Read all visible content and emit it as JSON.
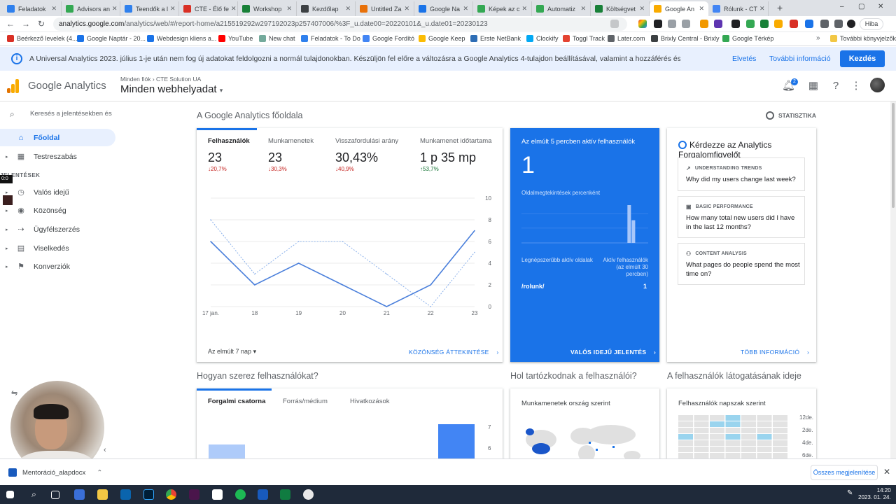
{
  "browser": {
    "tabs": [
      {
        "title": "Feladatok",
        "color": "#2f80ed"
      },
      {
        "title": "Advisors an",
        "color": "#34a853"
      },
      {
        "title": "Teendők a l",
        "color": "#2f80ed"
      },
      {
        "title": "CTE - Élő fe",
        "color": "#d93025"
      },
      {
        "title": "Workshop",
        "color": "#188038"
      },
      {
        "title": "Kezdőlap",
        "color": "#3c4043"
      },
      {
        "title": "Untitled Za",
        "color": "#e8710a"
      },
      {
        "title": "Google Na",
        "color": "#1a73e8"
      },
      {
        "title": "Képek az c",
        "color": "#34a853"
      },
      {
        "title": "Automatiz",
        "color": "#34a853"
      },
      {
        "title": "Költségvet",
        "color": "#188038"
      },
      {
        "title": "Google An",
        "color": "#f9ab00"
      },
      {
        "title": "Rólunk - CT",
        "color": "#4285f4"
      }
    ],
    "url_host": "analytics.google.com",
    "url_path": "/analytics/web/#/report-home/a215519292w297192023p257407006/%3F_u.date00=20220101&_u.date01=20230123",
    "profile_button": "Hiba",
    "bookmarks": [
      "Beérkező levelek (4...",
      "Google Naptár - 20...",
      "Webdesign kliens a...",
      "YouTube",
      "New chat",
      "Feladatok - To Do",
      "Google Fordító",
      "Google Keep",
      "Erste NetBank",
      "Clockify",
      "Toggl Track",
      "Later.com",
      "Brixly Central - Brixly",
      "Google Térkép"
    ],
    "other_bookmarks": "További könyvjelzők"
  },
  "banner": {
    "message": "A Universal Analytics 2023. július 1-je után nem fog új adatokat feldolgozni a normál tulajdonokban. Készüljön fel előre a változásra a Google Analytics 4-tulajdon beállításával, valamint a hozzáférés és eszközök beállításával.",
    "dismiss": "Elvetés",
    "more": "További információ",
    "start": "Kezdés"
  },
  "header": {
    "product": "Google Analytics",
    "crumb_root": "Minden fiók",
    "crumb_account": "CTE Solution UA",
    "view": "Minden webhelyadat",
    "notifications": "2"
  },
  "sidebar": {
    "search_placeholder": "Keresés a jelentésekben és",
    "items": [
      {
        "label": "Főoldal",
        "icon": "home-icon",
        "glyph": "⌂"
      },
      {
        "label": "Testreszabás",
        "icon": "dashboard-icon",
        "glyph": "▦"
      }
    ],
    "section": "JELENTÉSEK",
    "reports": [
      {
        "label": "Valós idejű",
        "icon": "clock-icon",
        "glyph": "◷"
      },
      {
        "label": "Közönség",
        "icon": "person-icon",
        "glyph": "◉"
      },
      {
        "label": "Ügyfélszerzés",
        "icon": "acquisition-icon",
        "glyph": "⇢"
      },
      {
        "label": "Viselkedés",
        "icon": "behavior-icon",
        "glyph": "▤"
      },
      {
        "label": "Konverziók",
        "icon": "flag-icon",
        "glyph": "⚑"
      }
    ],
    "timer": "0:0"
  },
  "main": {
    "title": "A Google Analytics főoldala",
    "insights_link": "STATISZTIKA",
    "metrics": [
      {
        "label": "Felhasználók",
        "value": "23",
        "delta": "20,7%",
        "dir": "down"
      },
      {
        "label": "Munkamenetek",
        "value": "23",
        "delta": "30,3%",
        "dir": "down"
      },
      {
        "label": "Visszafordulási arány",
        "value": "30,43%",
        "delta": "40,9%",
        "dir": "down"
      },
      {
        "label": "Munkamenet időtartama",
        "value": "1 p 35 mp",
        "delta": "53,7%",
        "dir": "up"
      }
    ],
    "range": "Az elmúlt 7 nap",
    "audience_link": "KÖZÖNSÉG ÁTTEKINTÉSE"
  },
  "chart_data": {
    "type": "line",
    "x": [
      "17 jan.",
      "18",
      "19",
      "20",
      "21",
      "22",
      "23"
    ],
    "ylim": [
      0,
      10
    ],
    "yticks": [
      "0",
      "2",
      "4",
      "6",
      "8",
      "10"
    ],
    "series": [
      {
        "values": [
          6,
          2,
          4,
          2,
          0,
          2,
          7
        ]
      },
      {
        "values": [
          8,
          3,
          6,
          6,
          3,
          0,
          5
        ]
      }
    ],
    "colors": {
      "current": "#4a7fdb",
      "previous": "#8ab0ea"
    }
  },
  "realtime": {
    "title": "Az elmúlt 5 percben aktív felhasználók",
    "value": "1",
    "pageviews_label": "Oldalmegtekintések percenként",
    "pageviews_per_minute": [
      0,
      0,
      0,
      0,
      0,
      0,
      0,
      0,
      0,
      0,
      0,
      0,
      0,
      0,
      0,
      0,
      0,
      0,
      0,
      0,
      0,
      0,
      0,
      0,
      0,
      10,
      6,
      0,
      0,
      0
    ],
    "col_pages": "Legnépszerűbb aktív oldalak",
    "col_users": "Aktív felhasználók (az elmúlt 30 percben)",
    "page": "/rolunk/",
    "count": "1",
    "link": "VALÓS IDEJŰ JELENTÉS"
  },
  "intelligence": {
    "title": "Kérdezze az Analytics Forgalomfigyelőt",
    "questions": [
      {
        "category": "UNDERSTANDING TRENDS",
        "glyph": "↗",
        "text": "Why did my users change last week?"
      },
      {
        "category": "BASIC PERFORMANCE",
        "glyph": "▣",
        "text": "How many total new users did I have in the last 12 months?"
      },
      {
        "category": "CONTENT ANALYSIS",
        "glyph": "⚇",
        "text": "What pages do people spend the most time on?"
      }
    ],
    "link": "TÖBB INFORMÁCIÓ"
  },
  "section2": {
    "acq_title": "Hogyan szerez felhasználókat?",
    "acq_tabs": [
      "Forgalmi csatorna",
      "Forrás/médium",
      "Hivatkozások"
    ],
    "acq_ticks": [
      "7",
      "6"
    ],
    "geo_title": "Hol tartózkodnak a felhasználói?",
    "geo_sub": "Munkamenetek ország szerint",
    "heat_title": "A felhasználók látogatásának ideje",
    "heat_sub": "Felhasználók napszak szerint",
    "heat_ticks": [
      "12de.",
      "2de.",
      "4de.",
      "6de."
    ]
  },
  "download": {
    "file": "Mentoráció_alapdocx",
    "show_all": "Összes megjelenítése"
  },
  "taskbar": {
    "time": "14:20",
    "date": "2023. 01. 24."
  }
}
